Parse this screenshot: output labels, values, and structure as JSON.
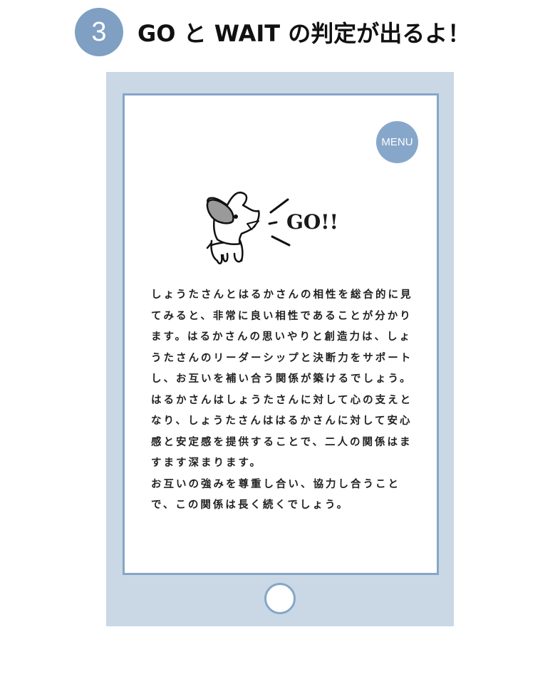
{
  "header": {
    "step_number": "3",
    "title": "GO と WAIT の判定が出るよ！"
  },
  "screen": {
    "menu_label": "MENU",
    "verdict": "GO!!",
    "result_paragraphs": [
      "しょうたさんとはるかさんの相性を総合的に見てみると、非常に良い相性であることが分かります。はるかさんの思いやりと創造力は、しょうたさんのリーダーシップと決断力をサポートし、お互いを補い合う関係が築けるでしょう。はるかさんはしょうたさんに対して心の支えとなり、しょうたさんははるかさんに対して安心感と安定感を提供することで、二人の関係はますます深まります。",
      "お互いの強みを尊重し合い、協力し合うことで、この関係は長く続くでしょう。"
    ]
  },
  "colors": {
    "accent": "#7f9fc3",
    "device_frame": "#cad8e6",
    "screen_border": "#86a6c8"
  },
  "icons": {
    "character": "dog-character-icon",
    "shout": "shout-lines-icon",
    "home": "home-button-icon"
  }
}
